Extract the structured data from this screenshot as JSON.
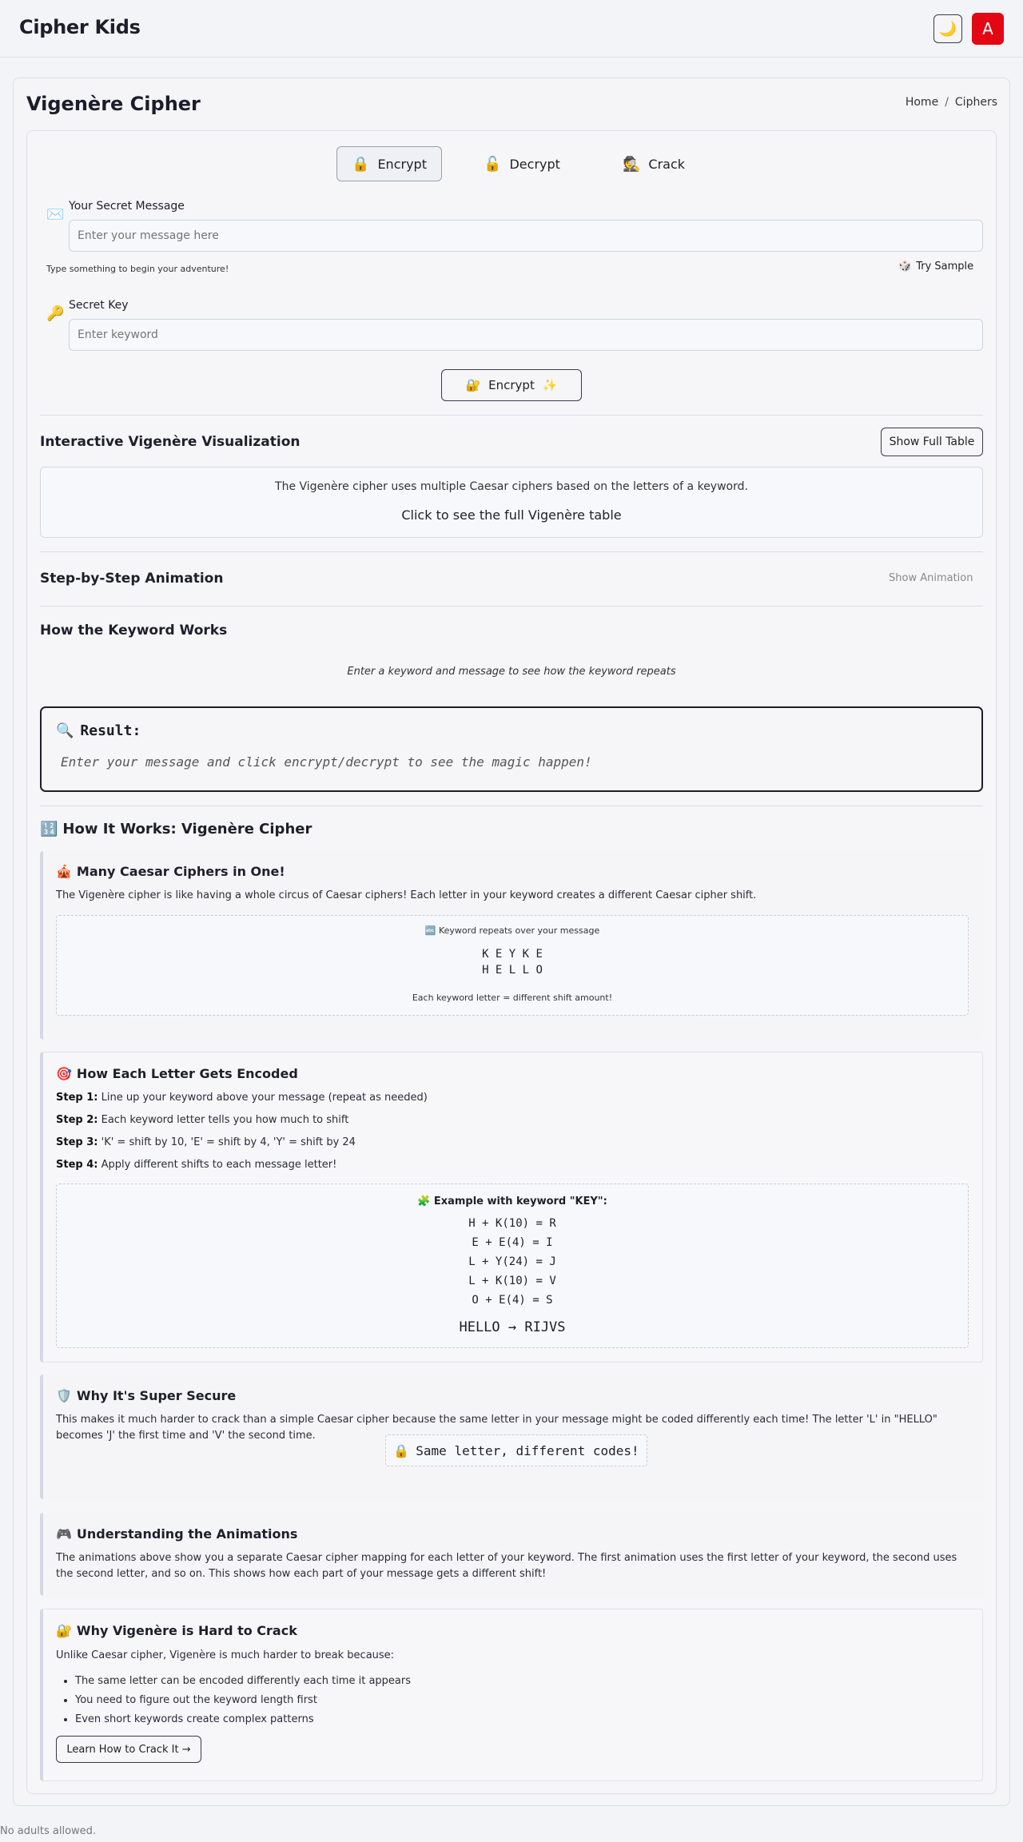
{
  "header": {
    "brand": "Cipher Kids",
    "theme_icon": "moon-icon",
    "avatar_letter": "A"
  },
  "page": {
    "title": "Vigenère Cipher",
    "breadcrumb": [
      "Home",
      "Ciphers"
    ]
  },
  "tabs": [
    {
      "icon": "🔒",
      "label": "Encrypt",
      "active": true
    },
    {
      "icon": "🔓",
      "label": "Decrypt",
      "active": false
    },
    {
      "icon": "🕵️",
      "label": "Crack",
      "active": false
    }
  ],
  "message": {
    "icon": "✉️",
    "label": "Your Secret Message",
    "placeholder": "Enter your message here",
    "hint": "Type something to begin your adventure!",
    "sample_icon": "🎲",
    "sample_label": "Try Sample"
  },
  "key": {
    "icon": "🔑",
    "label": "Secret Key",
    "placeholder": "Enter keyword"
  },
  "encrypt_button": {
    "icon_left": "🔐",
    "label": "Encrypt",
    "icon_right": "✨"
  },
  "visualization": {
    "title": "Interactive Vigenère Visualization",
    "button": "Show Full Table",
    "description": "The Vigenère cipher uses multiple Caesar ciphers based on the letters of a keyword.",
    "link": "Click to see the full Vigenère table"
  },
  "animation": {
    "title": "Step-by-Step Animation",
    "toggle": "Show Animation"
  },
  "keyword_section": {
    "title": "How the Keyword Works",
    "hint": "Enter a keyword and message to see how the keyword repeats"
  },
  "result": {
    "icon": "🔍",
    "title": "Result:",
    "text": "Enter your message and click encrypt/decrypt to see the magic happen!"
  },
  "how_it_works": {
    "icon": "🔢",
    "title": "How It Works: Vigenère Cipher",
    "panels": {
      "many": {
        "icon": "🎪",
        "title": "Many Caesar Ciphers in One!",
        "text": "The Vigenère cipher is like having a whole circus of Caesar ciphers! Each letter in your keyword creates a different Caesar cipher shift.",
        "box_icon": "🔤",
        "box_caption": "Keyword repeats over your message",
        "key_row": "K E Y K E",
        "msg_row": "H E L L O",
        "box_note": "Each keyword letter = different shift amount!"
      },
      "encode": {
        "icon": "🎯",
        "title": "How Each Letter Gets Encoded",
        "steps": [
          {
            "label": "Step 1:",
            "text": "Line up your keyword above your message (repeat as needed)"
          },
          {
            "label": "Step 2:",
            "text": "Each keyword letter tells you how much to shift"
          },
          {
            "label": "Step 3:",
            "text": "'K' = shift by 10, 'E' = shift by 4, 'Y' = shift by 24"
          },
          {
            "label": "Step 4:",
            "text": "Apply different shifts to each message letter!"
          }
        ],
        "example_icon": "🧩",
        "example_title": "Example with keyword \"KEY\":",
        "lines": [
          "H + K(10) = R",
          "E + E(4) = I",
          "L + Y(24) = J",
          "L + K(10) = V",
          "O + E(4) = S"
        ],
        "result": "HELLO → RIJVS"
      },
      "secure": {
        "icon": "🛡️",
        "title": "Why It's Super Secure",
        "text": "This makes it much harder to crack than a simple Caesar cipher because the same letter in your message might be coded differently each time! The letter 'L' in \"HELLO\" becomes 'J' the first time and 'V' the second time.",
        "pill_icon": "🔒",
        "pill_text": "Same letter, different codes!"
      },
      "animations": {
        "icon": "🎮",
        "title": "Understanding the Animations",
        "text": "The animations above show you a separate Caesar cipher mapping for each letter of your keyword. The first animation uses the first letter of your keyword, the second uses the second letter, and so on. This shows how each part of your message gets a different shift!"
      },
      "hard": {
        "icon": "🔐",
        "title": "Why Vigenère is Hard to Crack",
        "intro": "Unlike Caesar cipher, Vigenère is much harder to break because:",
        "bullets": [
          "The same letter can be encoded differently each time it appears",
          "You need to figure out the keyword length first",
          "Even short keywords create complex patterns"
        ],
        "button": "Learn How to Crack It →"
      }
    }
  },
  "footer": "No adults allowed."
}
